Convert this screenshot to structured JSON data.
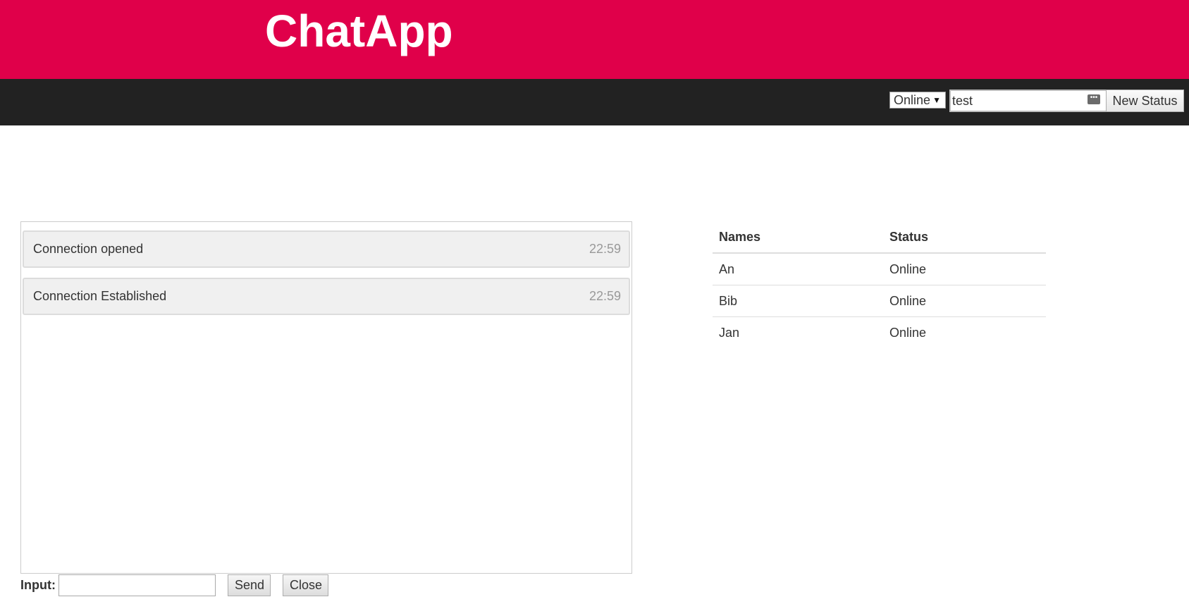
{
  "header": {
    "title": "ChatApp",
    "background_color": "#e0004a"
  },
  "navbar": {
    "status_select": {
      "selected": "Online",
      "caret_icon": "▼"
    },
    "status_message": {
      "value": "test",
      "icon": "password-dots-icon"
    },
    "new_status_label": "New Status",
    "background_color": "#222222"
  },
  "chat": {
    "messages": [
      {
        "text": "Connection opened",
        "time": "22:59"
      },
      {
        "text": "Connection Established",
        "time": "22:59"
      }
    ]
  },
  "input_bar": {
    "label": "Input:",
    "value": "",
    "send_label": "Send",
    "close_label": "Close"
  },
  "users": {
    "headers": [
      "Names",
      "Status"
    ],
    "rows": [
      {
        "name": "An",
        "status": "Online"
      },
      {
        "name": "Bib",
        "status": "Online"
      },
      {
        "name": "Jan",
        "status": "Online"
      }
    ]
  }
}
